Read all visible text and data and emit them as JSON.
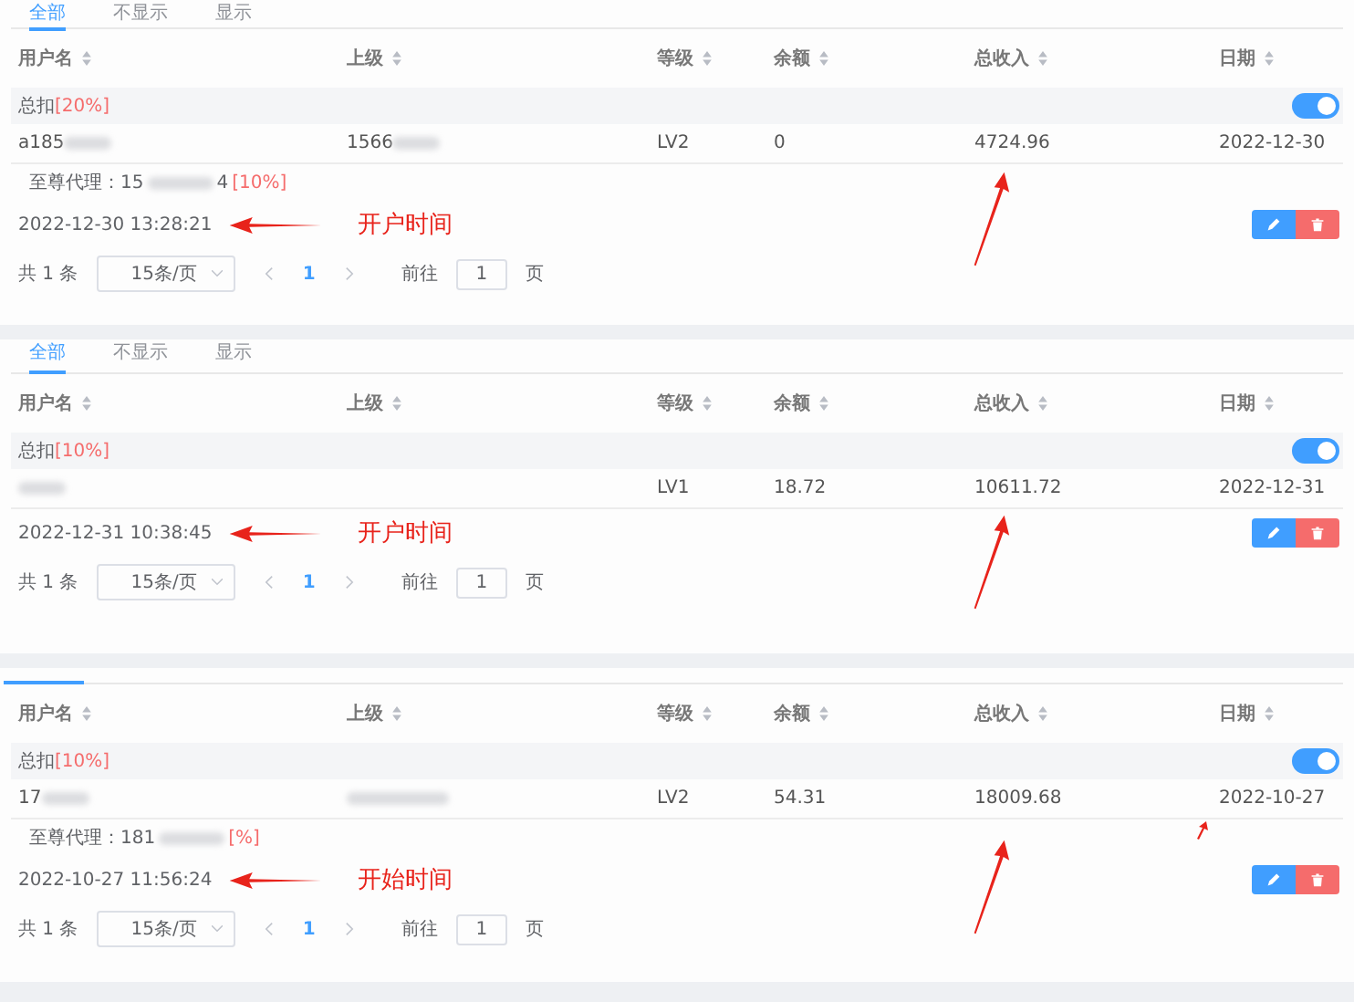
{
  "panels": [
    {
      "tabs": [
        {
          "label": "全部",
          "selected": true
        },
        {
          "label": "不显示",
          "selected": false
        },
        {
          "label": "显示",
          "selected": false
        }
      ],
      "columns": [
        "用户名",
        "上级",
        "等级",
        "余额",
        "总收入",
        "日期"
      ],
      "summary": {
        "label": "总扣",
        "rate": "[20%]",
        "on": true
      },
      "row": {
        "username": {
          "text": "a185",
          "redacted": true
        },
        "superior": {
          "text": "1566",
          "redacted": true
        },
        "level": "LV2",
        "balance": "0",
        "income": "4724.96",
        "date": "2022-12-30"
      },
      "agent": {
        "prefix": "至尊代理：15",
        "suffix": "4",
        "rate": "[10%]"
      },
      "created": "2022-12-30 13:28:21",
      "annotation": "开户时间",
      "stray_mark": false,
      "pagination": {
        "total": "共 1 条",
        "page_size": "15条/页",
        "page": "1",
        "goto": "前往",
        "goto_value": "1",
        "unit": "页"
      }
    },
    {
      "tabs": [
        {
          "label": "全部",
          "selected": true
        },
        {
          "label": "不显示",
          "selected": false
        },
        {
          "label": "显示",
          "selected": false
        }
      ],
      "columns": [
        "用户名",
        "上级",
        "等级",
        "余额",
        "总收入",
        "日期"
      ],
      "summary": {
        "label": "总扣",
        "rate": "[10%]",
        "on": true
      },
      "row": {
        "username": {
          "redacted": true
        },
        "level": "LV1",
        "balance": "18.72",
        "income": "10611.72",
        "date": "2022-12-31"
      },
      "created": "2022-12-31 10:38:45",
      "annotation": "开户时间",
      "stray_mark": false,
      "pagination": {
        "total": "共 1 条",
        "page_size": "15条/页",
        "page": "1",
        "goto": "前往",
        "goto_value": "1",
        "unit": "页"
      }
    },
    {
      "tab_indicator": true,
      "columns": [
        "用户名",
        "上级",
        "等级",
        "余额",
        "总收入",
        "日期"
      ],
      "summary": {
        "label": "总扣",
        "rate": "[10%]",
        "on": true
      },
      "row": {
        "username": {
          "text": "17",
          "redacted": true
        },
        "superior": {
          "redacted": true
        },
        "level": "LV2",
        "balance": "54.31",
        "income": "18009.68",
        "date": "2022-10-27"
      },
      "agent": {
        "prefix": "至尊代理：181",
        "rate": "[%]"
      },
      "created": "2022-10-27 11:56:24",
      "annotation": "开始时间",
      "stray_mark": true,
      "pagination": {
        "total": "共 1 条",
        "page_size": "15条/页",
        "page": "1",
        "goto": "前往",
        "goto_value": "1",
        "unit": "页"
      }
    }
  ]
}
